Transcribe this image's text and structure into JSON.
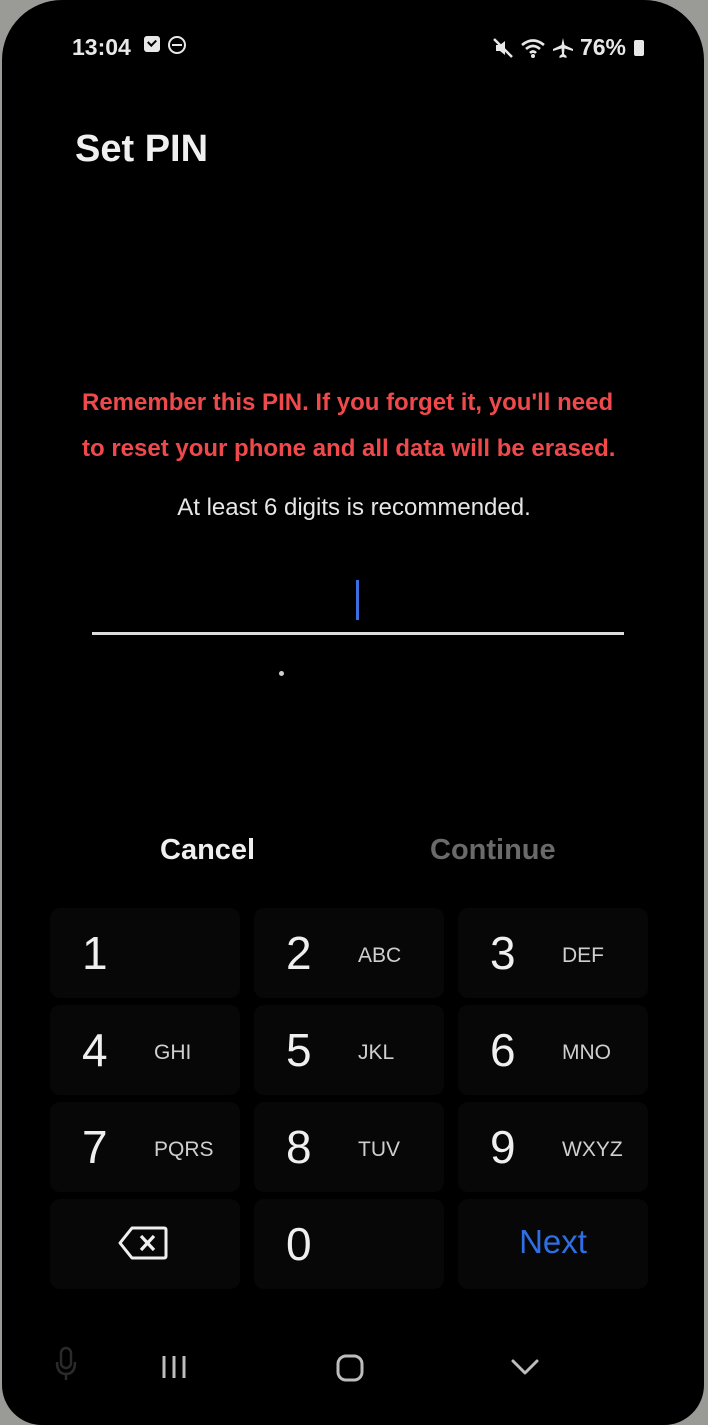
{
  "status_bar": {
    "time": "13:04",
    "battery": "76%",
    "icons": [
      "checkbox-notification-icon",
      "circle-notification-icon",
      "mute-icon",
      "wifi-icon",
      "airplane-icon",
      "battery-icon"
    ]
  },
  "screen": {
    "title": "Set PIN",
    "warning": "Remember this PIN. If you forget it, you'll need to reset your phone and all data will be erased.",
    "hint": "At least 6 digits is recommended.",
    "pin_value": ""
  },
  "actions": {
    "cancel": "Cancel",
    "continue": "Continue"
  },
  "keypad": {
    "keys": [
      {
        "num": "1",
        "letters": ""
      },
      {
        "num": "2",
        "letters": "ABC"
      },
      {
        "num": "3",
        "letters": "DEF"
      },
      {
        "num": "4",
        "letters": "GHI"
      },
      {
        "num": "5",
        "letters": "JKL"
      },
      {
        "num": "6",
        "letters": "MNO"
      },
      {
        "num": "7",
        "letters": "PQRS"
      },
      {
        "num": "8",
        "letters": "TUV"
      },
      {
        "num": "9",
        "letters": "WXYZ"
      },
      {
        "num": "0",
        "letters": ""
      }
    ],
    "next": "Next"
  },
  "colors": {
    "warning": "#f0494c",
    "accent": "#2f6fe6",
    "disabled": "#6a6a6a"
  }
}
